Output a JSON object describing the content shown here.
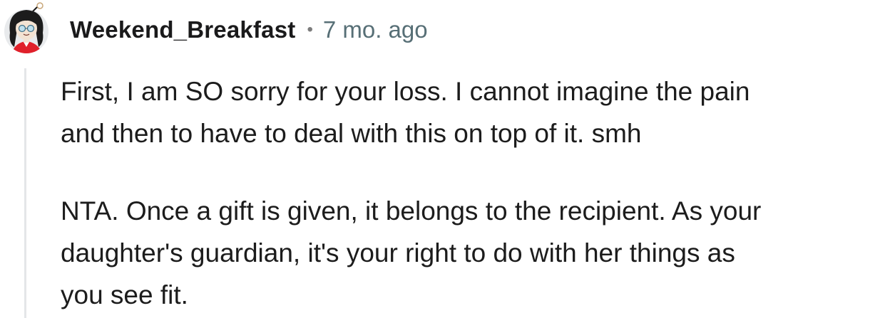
{
  "comment": {
    "username": "Weekend_Breakfast",
    "separator": "•",
    "timestamp": "7 mo. ago",
    "paragraphs": [
      {
        "lines": [
          "First, I am SO sorry for your loss. I cannot imagine the pain",
          "and then to have to deal with this on top of it. smh"
        ]
      },
      {
        "lines": [
          "NTA. Once a gift is given, it belongs to the recipient. As your",
          "daughter's guardian, it's your right to do with her things as",
          "you see fit."
        ]
      }
    ],
    "avatar": {
      "icon": "avatar-icon",
      "colors": {
        "background": "#e8eaec",
        "hair": "#1c1c1c",
        "skin": "#f3e3d3",
        "glasses": "#7fb0c8",
        "shirt": "#e0202a"
      }
    }
  },
  "colors": {
    "text": "#1c1c1c",
    "meta": "#576f76",
    "thread_line": "#e4e6e8"
  }
}
